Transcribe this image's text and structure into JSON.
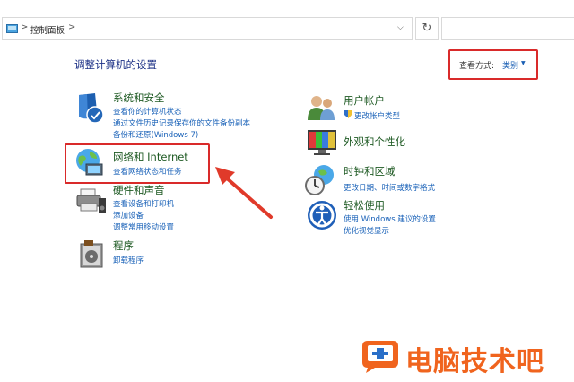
{
  "address_bar": {
    "breadcrumb": "控制面板",
    "separator": ">",
    "dropdown_glyph": "⌵",
    "refresh_glyph": "↻"
  },
  "page_heading": "调整计算机的设置",
  "view_by": {
    "label": "查看方式:",
    "value": "类别",
    "arrow": "▼"
  },
  "categories_left": [
    {
      "title": "系统和安全",
      "icon": "shield-security-icon",
      "links": [
        "查看你的计算机状态",
        "通过文件历史记录保存你的文件备份副本",
        "备份和还原(Windows 7)"
      ]
    },
    {
      "title": "网络和 Internet",
      "icon": "network-globe-icon",
      "links": [
        "查看网络状态和任务"
      ]
    },
    {
      "title": "硬件和声音",
      "icon": "printer-speaker-icon",
      "links": [
        "查看设备和打印机",
        "添加设备",
        "调整常用移动设置"
      ]
    },
    {
      "title": "程序",
      "icon": "programs-disc-icon",
      "links": [
        "卸载程序"
      ]
    }
  ],
  "categories_right": [
    {
      "title": "用户帐户",
      "icon": "users-icon",
      "links": [
        "更改帐户类型"
      ]
    },
    {
      "title": "外观和个性化",
      "icon": "monitor-appearance-icon",
      "links": []
    },
    {
      "title": "时钟和区域",
      "icon": "clock-globe-icon",
      "links": [
        "更改日期、时间或数字格式"
      ]
    },
    {
      "title": "轻松使用",
      "icon": "ease-of-access-icon",
      "links": [
        "使用 Windows 建议的设置",
        "优化视觉显示"
      ]
    }
  ],
  "watermark": {
    "text": "电脑技术吧"
  },
  "colors": {
    "highlight_red": "#d92a2a",
    "link_blue": "#1a62b8",
    "heading_blue": "#1e3287",
    "category_green": "#1f6a26",
    "watermark_orange": "#f0641e"
  }
}
